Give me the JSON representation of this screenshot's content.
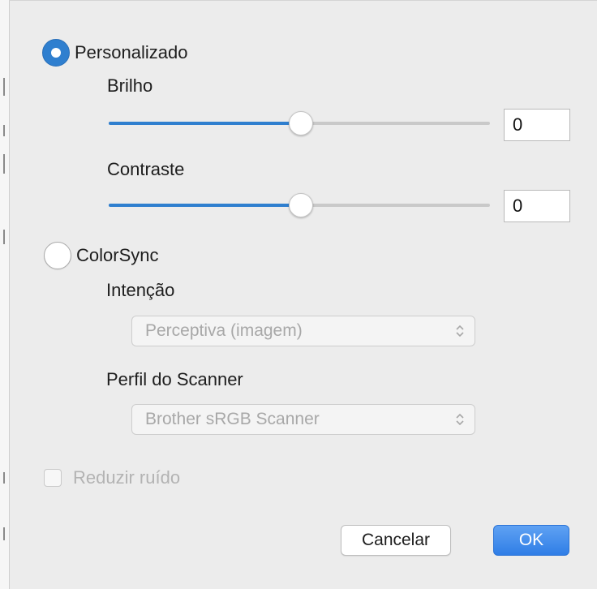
{
  "custom": {
    "label": "Personalizado",
    "selected": true
  },
  "brightness": {
    "label": "Brilho",
    "value": "0",
    "slider_level": 0.5
  },
  "contrast": {
    "label": "Contraste",
    "value": "0",
    "slider_level": 0.5
  },
  "colorsync": {
    "label": "ColorSync",
    "selected": false
  },
  "intent": {
    "label": "Intenção",
    "selected": "Perceptiva (imagem)"
  },
  "scanner_profile": {
    "label": "Perfil do Scanner",
    "selected": "Brother sRGB Scanner"
  },
  "noise": {
    "label": "Reduzir ruído",
    "checked": false
  },
  "buttons": {
    "cancel": "Cancelar",
    "ok": "OK"
  },
  "colors": {
    "accent": "#2f7fcf",
    "primary_button": "#3a86ec",
    "background": "#ececec"
  }
}
